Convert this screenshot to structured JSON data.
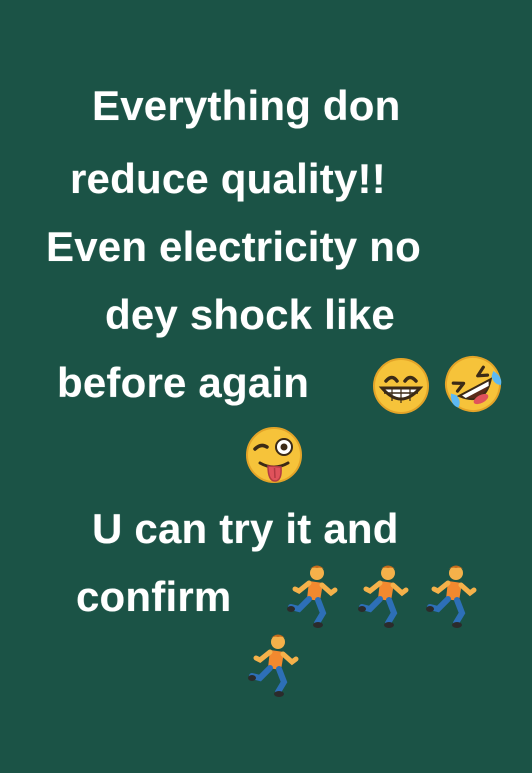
{
  "post": {
    "background_color": "#1b5346",
    "text_color": "#ffffff",
    "lines": [
      "Everything don",
      "reduce quality!!",
      "Even electricity no",
      "dey shock like",
      "before again",
      "U can try it and",
      "confirm"
    ],
    "emojis": [
      "grinning-face-with-smiling-eyes",
      "rolling-on-the-floor-laughing",
      "winking-face-with-tongue",
      "man-running",
      "man-running",
      "man-running",
      "man-running"
    ]
  }
}
